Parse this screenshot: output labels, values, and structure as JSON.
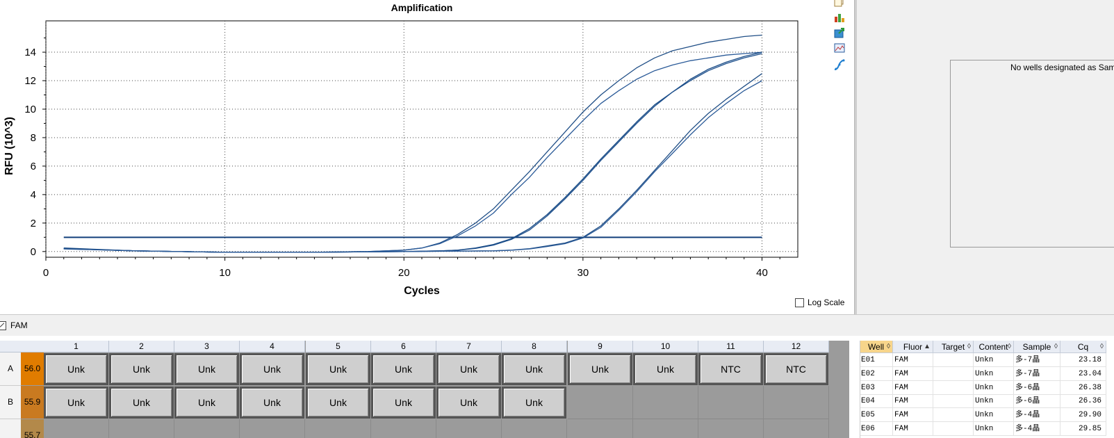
{
  "chart_data": {
    "type": "line",
    "title": "Amplification",
    "xlabel": "Cycles",
    "ylabel": "RFU (10^3)",
    "xlim": [
      0,
      42
    ],
    "ylim": [
      -0.4,
      16.2
    ],
    "xticks": [
      0,
      10,
      20,
      30,
      40
    ],
    "yticks": [
      0,
      2,
      4,
      6,
      8,
      10,
      12,
      14
    ],
    "grid": true,
    "threshold": 1.0,
    "series": [
      {
        "x": [
          1,
          5,
          10,
          15,
          18,
          19,
          20,
          21,
          22,
          23,
          24,
          25,
          26,
          27,
          28,
          29,
          30,
          31,
          32,
          33,
          34,
          35,
          36,
          37,
          38,
          39,
          40
        ],
        "values": [
          0.25,
          0.05,
          -0.05,
          -0.05,
          0.0,
          0.05,
          0.1,
          0.25,
          0.6,
          1.2,
          2.0,
          3.0,
          4.3,
          5.6,
          7.0,
          8.4,
          9.8,
          11.0,
          12.0,
          12.9,
          13.6,
          14.1,
          14.4,
          14.7,
          14.9,
          15.1,
          15.2
        ],
        "color": "#1f4e86"
      },
      {
        "x": [
          1,
          5,
          10,
          15,
          18,
          19,
          20,
          21,
          22,
          23,
          24,
          25,
          26,
          27,
          28,
          29,
          30,
          31,
          32,
          33,
          34,
          35,
          36,
          37,
          38,
          39,
          40
        ],
        "values": [
          0.2,
          0.05,
          -0.05,
          -0.05,
          0.0,
          0.05,
          0.1,
          0.25,
          0.55,
          1.1,
          1.8,
          2.7,
          4.0,
          5.2,
          6.6,
          7.9,
          9.2,
          10.4,
          11.3,
          12.1,
          12.7,
          13.1,
          13.4,
          13.6,
          13.8,
          13.9,
          14.0
        ],
        "color": "#2a5a98"
      },
      {
        "x": [
          1,
          5,
          10,
          15,
          20,
          22,
          23,
          24,
          25,
          26,
          27,
          28,
          29,
          30,
          31,
          32,
          33,
          34,
          35,
          36,
          37,
          38,
          39,
          40
        ],
        "values": [
          0.22,
          0.05,
          -0.05,
          -0.05,
          0.0,
          0.05,
          0.1,
          0.25,
          0.5,
          0.9,
          1.6,
          2.6,
          3.8,
          5.1,
          6.5,
          7.8,
          9.1,
          10.3,
          11.2,
          12.1,
          12.8,
          13.3,
          13.7,
          14.0
        ],
        "color": "#174a85"
      },
      {
        "x": [
          1,
          5,
          10,
          15,
          20,
          22,
          23,
          24,
          25,
          26,
          27,
          28,
          29,
          30,
          31,
          32,
          33,
          34,
          35,
          36,
          37,
          38,
          39,
          40
        ],
        "values": [
          0.2,
          0.05,
          -0.05,
          -0.05,
          0.0,
          0.05,
          0.1,
          0.22,
          0.45,
          0.85,
          1.5,
          2.5,
          3.7,
          5.0,
          6.4,
          7.7,
          9.0,
          10.2,
          11.2,
          12.0,
          12.7,
          13.2,
          13.6,
          13.9
        ],
        "color": "#1d4f8c"
      },
      {
        "x": [
          1,
          5,
          10,
          15,
          20,
          25,
          26,
          27,
          28,
          29,
          30,
          31,
          32,
          33,
          34,
          35,
          36,
          37,
          38,
          39,
          40
        ],
        "values": [
          0.2,
          0.05,
          -0.05,
          -0.05,
          0.0,
          0.05,
          0.1,
          0.2,
          0.4,
          0.6,
          1.0,
          1.8,
          3.0,
          4.3,
          5.7,
          7.1,
          8.5,
          9.7,
          10.7,
          11.6,
          12.5
        ],
        "color": "#1f4e86"
      },
      {
        "x": [
          1,
          5,
          10,
          15,
          20,
          25,
          26,
          27,
          28,
          29,
          30,
          31,
          32,
          33,
          34,
          35,
          36,
          37,
          38,
          39,
          40
        ],
        "values": [
          0.18,
          0.05,
          -0.05,
          -0.05,
          0.0,
          0.05,
          0.1,
          0.18,
          0.35,
          0.55,
          0.95,
          1.7,
          2.9,
          4.2,
          5.6,
          6.9,
          8.2,
          9.4,
          10.4,
          11.3,
          12.0
        ],
        "color": "#2a5a98"
      }
    ]
  },
  "log_scale": {
    "label": "Log Scale",
    "checked": false
  },
  "right_panel": {
    "message": "No wells designated as Sample"
  },
  "fluor": {
    "label": "FAM",
    "checked": true
  },
  "plate": {
    "columns": [
      "1",
      "2",
      "3",
      "4",
      "5",
      "6",
      "7",
      "8",
      "9",
      "10",
      "11",
      "12"
    ],
    "rows": [
      {
        "label": "A",
        "temp": "56.0",
        "temp_color": "#e07c00",
        "wells": [
          "Unk",
          "Unk",
          "Unk",
          "Unk",
          "Unk",
          "Unk",
          "Unk",
          "Unk",
          "Unk",
          "Unk",
          "NTC",
          "NTC"
        ]
      },
      {
        "label": "B",
        "temp": "55.9",
        "temp_color": "#c97a20",
        "wells": [
          "Unk",
          "Unk",
          "Unk",
          "Unk",
          "Unk",
          "Unk",
          "Unk",
          "Unk",
          "",
          "",
          "",
          ""
        ]
      },
      {
        "label": "",
        "temp": "55.7",
        "temp_color": "#b3894a",
        "wells": [
          "",
          "",
          "",
          "",
          "",
          "",
          "",
          "",
          "",
          "",
          "",
          ""
        ]
      }
    ]
  },
  "results_table": {
    "headers": [
      "Well",
      "Fluor",
      "Target",
      "Content",
      "Sample",
      "Cq"
    ],
    "rows": [
      [
        "E01",
        "FAM",
        "",
        "Unkn",
        "多-7晶",
        "23.18"
      ],
      [
        "E02",
        "FAM",
        "",
        "Unkn",
        "多-7晶",
        "23.04"
      ],
      [
        "E03",
        "FAM",
        "",
        "Unkn",
        "多-6晶",
        "26.38"
      ],
      [
        "E04",
        "FAM",
        "",
        "Unkn",
        "多-6晶",
        "26.36"
      ],
      [
        "E05",
        "FAM",
        "",
        "Unkn",
        "多-4晶",
        "29.90"
      ],
      [
        "E06",
        "FAM",
        "",
        "Unkn",
        "多-4晶",
        "29.85"
      ]
    ]
  },
  "toolbar_icons": [
    "copy-icon",
    "chart-settings-icon",
    "export-icon",
    "image-icon",
    "curve-icon"
  ]
}
